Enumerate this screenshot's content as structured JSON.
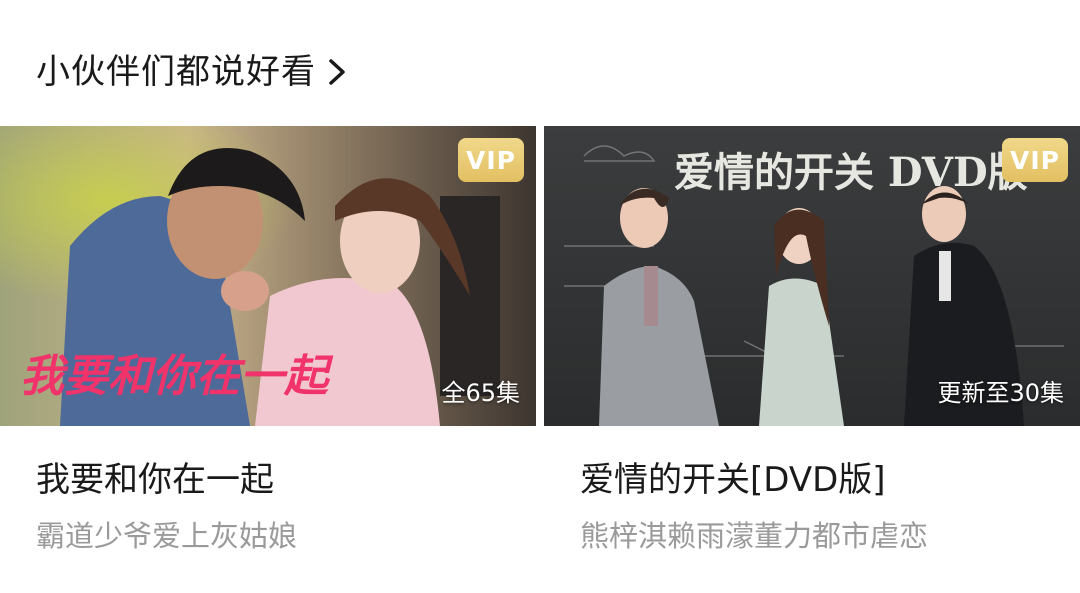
{
  "section": {
    "title": "小伙伴们都说好看",
    "more_icon": "chevron-right-icon"
  },
  "cards": [
    {
      "title": "我要和你在一起",
      "subtitle": "霸道少爷爱上灰姑娘",
      "badge": "VIP",
      "episodes": "全65集",
      "poster_art_text": "我要和你在一起"
    },
    {
      "title": "爱情的开关[DVD版]",
      "subtitle": "熊梓淇赖雨濛董力都市虐恋",
      "badge": "VIP",
      "episodes": "更新至30集",
      "poster_art_text": "爱情的开关 DVD版"
    }
  ],
  "colors": {
    "vip_gold": "#e2bf62",
    "title_text": "#1a1a1a",
    "subtitle_text": "#9a9a9a"
  }
}
